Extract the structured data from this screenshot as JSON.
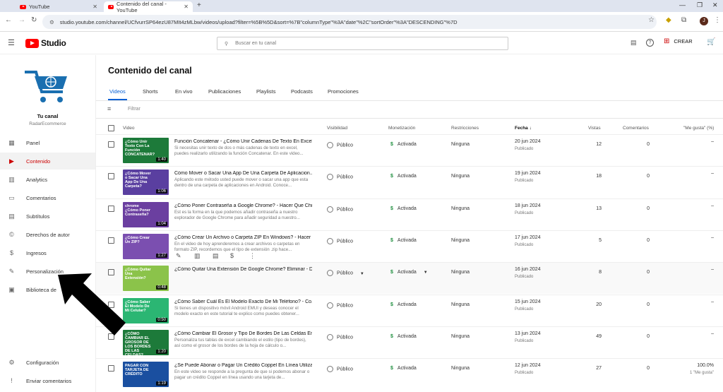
{
  "browser": {
    "tabs": [
      {
        "label": "YouTube"
      },
      {
        "label": "Contenido del canal - YouTube"
      }
    ],
    "new_tab": "+",
    "url": "studio.youtube.com/channel/UCfvurrSP64ezU87MIt4zMLbw/videos/upload?filter=%5B%5D&sort=%7B\"columnType\"%3A\"date\"%2C\"sortOrder\"%3A\"DESCENDING\"%7D"
  },
  "header": {
    "studio_label": "Studio",
    "search_placeholder": "Buscar en tu canal",
    "create_label": "CREAR"
  },
  "channel": {
    "name": "Tu canal",
    "handle": "RadarEcommerce"
  },
  "sidebar": {
    "items": [
      {
        "label": "Panel",
        "icon": "dashboard-icon"
      },
      {
        "label": "Contenido",
        "icon": "content-icon"
      },
      {
        "label": "Analytics",
        "icon": "analytics-icon"
      },
      {
        "label": "Comentarios",
        "icon": "comments-icon"
      },
      {
        "label": "Subtítulos",
        "icon": "subtitles-icon"
      },
      {
        "label": "Derechos de autor",
        "icon": "copyright-icon"
      },
      {
        "label": "Ingresos",
        "icon": "earn-icon"
      },
      {
        "label": "Personalización",
        "icon": "customization-icon"
      },
      {
        "label": "Biblioteca de",
        "icon": "library-icon"
      }
    ],
    "bottom": [
      {
        "label": "Configuración"
      },
      {
        "label": "Enviar comentarios"
      }
    ]
  },
  "main": {
    "title": "Contenido del canal",
    "tabs": [
      "Videos",
      "Shorts",
      "En vivo",
      "Publicaciones",
      "Playlists",
      "Podcasts",
      "Promociones"
    ],
    "filter_label": "Filtrar",
    "columns": {
      "video": "Video",
      "visibility": "Visibilidad",
      "monetization": "Monetización",
      "restrictions": "Restricciones",
      "date": "Fecha",
      "views": "Vistas",
      "comments": "Comentarios",
      "likes": "\"Me gusta\" (%)"
    }
  },
  "rows": [
    {
      "title": "Función Concatenar - ¿Cómo Unir Cadenas De Texto En Excel...",
      "desc": "Si necesitas unir texto de dos o más cadenas de texto en excel, puedes realizarlo utilizando la función Concatenar. En este video...",
      "thumb_text": "¿Cómo Unir Texto Con La Función CONCATENAR?",
      "duration": "1:40",
      "visibility": "Público",
      "monetization": "Activada",
      "restrictions": "Ninguna",
      "date": "20 jun 2024",
      "status": "Publicado",
      "views": "12",
      "comments": "0",
      "likes": "–",
      "thumb_color": "#1d7a3a"
    },
    {
      "title": "Cómo Mover o Sacar Una App De Una Carpeta De Aplicacion...",
      "desc": "Aplicando este método usted puede mover o sacar una app que esta dentro de una carpeta de aplicaciones en Android. Conoce...",
      "thumb_text": "¿Cómo Mover o Sacar Una App De Una Carpeta?",
      "duration": "1:06",
      "visibility": "Público",
      "monetization": "Activada",
      "restrictions": "Ninguna",
      "date": "19 jun 2024",
      "status": "Publicado",
      "views": "18",
      "comments": "0",
      "likes": "–",
      "thumb_color": "#5a3fa0"
    },
    {
      "title": "¿Cómo Poner Contraseña a Google Chrome? - Hacer Que Chr...",
      "desc": "Est es la forma en la que podemos añadir contraseña a nuestro explorador de Google Chrome para añadir seguridad a nuestro...",
      "thumb_text": "chrome ¿Cómo Poner Contraseña?",
      "duration": "1:04",
      "visibility": "Público",
      "monetization": "Activada",
      "restrictions": "Ninguna",
      "date": "18 jun 2024",
      "status": "Publicado",
      "views": "13",
      "comments": "0",
      "likes": "–",
      "thumb_color": "#6b3fa0"
    },
    {
      "title": "¿Cómo Crear Un Archivo o Carpeta ZIP En Windows? - Hacer ...",
      "desc": "En el video de hoy aprenderemos a crear archivos o carpetas en formato ZIP, recordemos que el tipo de extensión .zip hace...",
      "thumb_text": "¿Cómo Crear Un ZIP?",
      "duration": "1:27",
      "visibility": "Público",
      "monetization": "Activada",
      "restrictions": "Ninguna",
      "date": "17 jun 2024",
      "status": "Publicado",
      "views": "5",
      "comments": "0",
      "likes": "–",
      "thumb_color": "#7b4fb0"
    },
    {
      "title": "¿Cómo Quitar Una Extensión De Google Chrome? Eliminar - D...",
      "desc": "",
      "thumb_text": "¿Cómo Quitar Una Extensión?",
      "duration": "0:48",
      "visibility": "Público",
      "monetization": "Activada",
      "restrictions": "Ninguna",
      "date": "16 jun 2024",
      "status": "Publicado",
      "views": "8",
      "comments": "0",
      "likes": "–",
      "thumb_color": "#8bc34a"
    },
    {
      "title": "¿Cómo Saber Cuál Es El Modelo Exacto De Mi Teléfono? - Co...",
      "desc": "Si tienes un dispositivo móvil Android EMUI y deseas conocer el modelo exacto en este tutorial te explico como puedes obtener...",
      "thumb_text": "¿Cómo Saber El Modelo De Mi Celular?",
      "duration": "0:50",
      "visibility": "Público",
      "monetization": "Activada",
      "restrictions": "Ninguna",
      "date": "15 jun 2024",
      "status": "Publicado",
      "views": "20",
      "comments": "0",
      "likes": "–",
      "thumb_color": "#2bb673"
    },
    {
      "title": "¿Cómo Cambiar El Grosor y Tipo De Bordes De Las Celdas En...",
      "desc": "Personaliza tus tablas de excel cambiando el estilo (tipo de bordes), así como el grosor de los bordes de la hoja de cálculo o...",
      "thumb_text": "¿CÓMO CAMBIAR EL GROSOR DE LOS BORDES DE LAS CELDAS?",
      "duration": "1:20",
      "visibility": "Público",
      "monetization": "Activada",
      "restrictions": "Ninguna",
      "date": "13 jun 2024",
      "status": "Publicado",
      "views": "49",
      "comments": "0",
      "likes": "–",
      "thumb_color": "#1d7a3a"
    },
    {
      "title": "¿Se Puede Abonar o Pagar Un Crédito Coppel En Línea Utiliza...",
      "desc": "En este video se responde a la pregunta de que si podemos abonar o pagar un crédito Coppel en línea usando una tarjeta de...",
      "thumb_text": "PAGAR CON TARJETA DE CRÉDITO",
      "duration": "1:19",
      "visibility": "Público",
      "monetization": "Activada",
      "restrictions": "Ninguna",
      "date": "12 jun 2024",
      "status": "Publicado",
      "views": "27",
      "comments": "0",
      "likes": "100.0%",
      "likes_sub": "1 \"Me gusta\"",
      "thumb_color": "#1a4fa0"
    }
  ],
  "colors": {
    "accent": "#065fd4",
    "brand": "#ff0000",
    "monetized": "#1e8e3e",
    "active_side": "#cc0000"
  }
}
